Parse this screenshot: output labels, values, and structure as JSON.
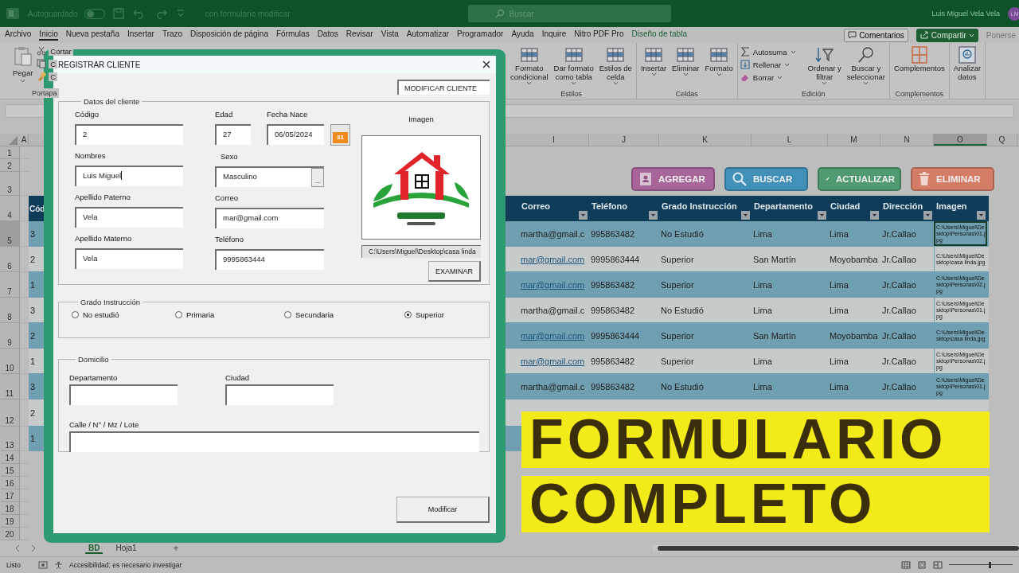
{
  "title_bar": {
    "autosave_label": "Autoguardado",
    "autosave_on": false,
    "document_title": "con formulario modificar",
    "search_placeholder": "Buscar",
    "user_name": "Luis Miguel Vela Vela",
    "user_initials": "LM"
  },
  "menu_tabs": [
    {
      "label": "Archivo",
      "selected": false,
      "contextual": false
    },
    {
      "label": "Inicio",
      "selected": true,
      "contextual": false
    },
    {
      "label": "Nueva pestaña",
      "selected": false,
      "contextual": false
    },
    {
      "label": "Insertar",
      "selected": false,
      "contextual": false
    },
    {
      "label": "Trazo",
      "selected": false,
      "contextual": false
    },
    {
      "label": "Disposición de página",
      "selected": false,
      "contextual": false
    },
    {
      "label": "Fórmulas",
      "selected": false,
      "contextual": false
    },
    {
      "label": "Datos",
      "selected": false,
      "contextual": false
    },
    {
      "label": "Revisar",
      "selected": false,
      "contextual": false
    },
    {
      "label": "Vista",
      "selected": false,
      "contextual": false
    },
    {
      "label": "Automatizar",
      "selected": false,
      "contextual": false
    },
    {
      "label": "Programador",
      "selected": false,
      "contextual": false
    },
    {
      "label": "Ayuda",
      "selected": false,
      "contextual": false
    },
    {
      "label": "Inquire",
      "selected": false,
      "contextual": false
    },
    {
      "label": "Nitro PDF Pro",
      "selected": false,
      "contextual": false
    },
    {
      "label": "Diseño de tabla",
      "selected": false,
      "contextual": true
    }
  ],
  "menu_actions": {
    "comments": "Comentarios",
    "share": "Compartir",
    "coauthor": "Ponerse"
  },
  "ribbon": {
    "clipboard": {
      "paste": "Pegar",
      "group": "Portapa",
      "items": [
        {
          "label": "Cortar"
        },
        {
          "label": "C"
        },
        {
          "label": "C"
        }
      ]
    },
    "groups": [
      {
        "label": "Estilos",
        "buttons": [
          {
            "lines": [
              "Formato",
              "condicional"
            ],
            "menu": true
          },
          {
            "lines": [
              "Dar formato",
              "como tabla"
            ],
            "menu": true
          },
          {
            "lines": [
              "Estilos de",
              "celda"
            ],
            "menu": true
          }
        ]
      },
      {
        "label": "Celdas",
        "buttons": [
          {
            "lines": [
              "Insertar"
            ],
            "menu": true
          },
          {
            "lines": [
              "Eliminar"
            ],
            "menu": true
          },
          {
            "lines": [
              "Formato"
            ],
            "menu": true
          }
        ]
      },
      {
        "label": "Edición",
        "stack": [
          {
            "label": "Autosuma",
            "menu": true
          },
          {
            "label": "Rellenar",
            "menu": true
          },
          {
            "label": "Borrar",
            "menu": true
          }
        ],
        "buttons": [
          {
            "lines": [
              "Ordenar y",
              "filtrar"
            ],
            "menu": true
          },
          {
            "lines": [
              "Buscar y",
              "seleccionar"
            ],
            "menu": true
          }
        ]
      },
      {
        "label": "Complementos",
        "buttons": [
          {
            "lines": [
              "Complementos"
            ],
            "menu": false
          }
        ]
      },
      {
        "buttons": [
          {
            "lines": [
              "Analizar",
              "datos"
            ],
            "menu": false
          }
        ]
      }
    ]
  },
  "column_letters_left": [
    "A"
  ],
  "column_letters": [
    {
      "label": "I",
      "selected": false
    },
    {
      "label": "J",
      "selected": false
    },
    {
      "label": "K",
      "selected": false
    },
    {
      "label": "L",
      "selected": false
    },
    {
      "label": "M",
      "selected": false
    },
    {
      "label": "N",
      "selected": false
    },
    {
      "label": "O",
      "selected": true
    },
    {
      "label": "Q",
      "selected": false
    }
  ],
  "row_numbers": [
    {
      "label": "1",
      "selected": false
    },
    {
      "label": "2",
      "selected": false
    },
    {
      "label": "3",
      "selected": false
    },
    {
      "label": "4",
      "selected": false
    },
    {
      "label": "5",
      "selected": true
    },
    {
      "label": "6",
      "selected": false
    },
    {
      "label": "7",
      "selected": false
    },
    {
      "label": "8",
      "selected": false
    },
    {
      "label": "9",
      "selected": false
    },
    {
      "label": "10",
      "selected": false
    },
    {
      "label": "11",
      "selected": false
    },
    {
      "label": "12",
      "selected": false
    },
    {
      "label": "13",
      "selected": false
    },
    {
      "label": "14",
      "selected": false
    },
    {
      "label": "15",
      "selected": false
    },
    {
      "label": "16",
      "selected": false
    },
    {
      "label": "17",
      "selected": false
    },
    {
      "label": "18",
      "selected": false
    },
    {
      "label": "19",
      "selected": false
    },
    {
      "label": "20",
      "selected": false
    }
  ],
  "action_buttons": [
    {
      "label": "AGREGAR",
      "kind": "add",
      "color": "#a8659a"
    },
    {
      "label": "BUSCAR",
      "kind": "search",
      "color": "#4190b8"
    },
    {
      "label": "ACTUALIZAR",
      "kind": "edit",
      "color": "#4f9a70"
    },
    {
      "label": "ELIMINAR",
      "kind": "delete",
      "color": "#d57d66"
    }
  ],
  "table": {
    "code_header": "Cód",
    "columns": [
      "Correo",
      "Teléfono",
      "Grado Instrucción",
      "Departamento",
      "Ciudad",
      "Dirección",
      "Imagen"
    ],
    "rows": [
      {
        "code": "3",
        "email": "martha@gmail.c",
        "email_link": false,
        "phone": "995863482",
        "grade": "No Estudió",
        "department": "Lima",
        "city": "Lima",
        "address": "Jr.Callao",
        "image": "C:\\Users\\Miguel\\Desktop\\Personas\\01.jpg",
        "selected": true
      },
      {
        "code": "2",
        "email": "mar@gmail.com",
        "email_link": true,
        "phone": "9995863444",
        "grade": "Superior",
        "department": "San Martín",
        "city": "Moyobamba",
        "address": "Jr.Callao",
        "image": "C:\\Users\\Miguel\\Desktop\\casa linda.jpg",
        "selected": false
      },
      {
        "code": "1",
        "email": "mar@gmail.com",
        "email_link": true,
        "phone": "995863482",
        "grade": "Superior",
        "department": "Lima",
        "city": "Lima",
        "address": "Jr.Callao",
        "image": "C:\\Users\\Miguel\\Desktop\\Personas\\02.jpg",
        "selected": false
      },
      {
        "code": "3",
        "email": "martha@gmail.c",
        "email_link": false,
        "phone": "995863482",
        "grade": "No Estudió",
        "department": "Lima",
        "city": "Lima",
        "address": "Jr.Callao",
        "image": "C:\\Users\\Miguel\\Desktop\\Personas\\01.jpg",
        "selected": false
      },
      {
        "code": "2",
        "email": "mar@gmail.com",
        "email_link": true,
        "phone": "9995863444",
        "grade": "Superior",
        "department": "San Martín",
        "city": "Moyobamba",
        "address": "Jr.Callao",
        "image": "C:\\Users\\Miguel\\Desktop\\casa linda.jpg",
        "selected": false
      },
      {
        "code": "1",
        "email": "mar@gmail.com",
        "email_link": true,
        "phone": "995863482",
        "grade": "Superior",
        "department": "Lima",
        "city": "Lima",
        "address": "Jr.Callao",
        "image": "C:\\Users\\Miguel\\Desktop\\Personas\\02.jpg",
        "selected": false
      },
      {
        "code": "3",
        "email": "martha@gmail.c",
        "email_link": false,
        "phone": "995863482",
        "grade": "No Estudió",
        "department": "Lima",
        "city": "Lima",
        "address": "Jr.Callao",
        "image": "C:\\Users\\Miguel\\Desktop\\Personas\\01.jpg",
        "selected": false
      },
      {
        "code": "2"
      },
      {
        "code": "1"
      }
    ]
  },
  "sheet_tabs": [
    {
      "label": "BD",
      "selected": true
    },
    {
      "label": "Hoja1",
      "selected": false
    }
  ],
  "add_sheet": "+",
  "status_bar": {
    "ready": "Listo",
    "accessibility": "Accesibilidad: es necesario investigar",
    "zoom": {
      "level": 0.65
    }
  },
  "form": {
    "title": "REGISTRAR CLIENTE",
    "mode_label": "MODIFICAR CLIENTE",
    "client_frame": {
      "title": "Datos del cliente",
      "code": {
        "label": "Código",
        "value": "2"
      },
      "age": {
        "label": "Edad",
        "value": "27"
      },
      "birth_date": {
        "label": "Fecha Nace",
        "value": "06/05/2024"
      },
      "calendar_button": "31",
      "names": {
        "label": "Nombres",
        "value": "Luis Miguel",
        "focused": true
      },
      "sex": {
        "label": "Sexo",
        "value": "Masculino",
        "picker_button": "..."
      },
      "surname_paternal": {
        "label": "Apellido Paterno",
        "value": "Vela"
      },
      "email": {
        "label": "Correo",
        "value": "mar@gmail.com"
      },
      "surname_maternal": {
        "label": "Apellido Materno",
        "value": "Vela"
      },
      "phone": {
        "label": "Teléfono",
        "value": "9995863444"
      },
      "image_label": "Imagen",
      "image_path": "C:\\Users\\Miguel\\Desktop\\casa linda",
      "browse_button": "EXAMINAR"
    },
    "grade_frame": {
      "title": "Grado Instrucción",
      "options": [
        {
          "label": "No estudió",
          "selected": false
        },
        {
          "label": "Primaria",
          "selected": false
        },
        {
          "label": "Secundaria",
          "selected": false
        },
        {
          "label": "Superior",
          "selected": true
        }
      ]
    },
    "address_frame": {
      "title": "Domicilio",
      "department": "Departamento",
      "city": "Ciudad",
      "street": "Calle / N° / Mz / Lote"
    },
    "submit_button": "Modificar"
  },
  "banners": [
    "FORMULARIO",
    "COMPLETO"
  ]
}
